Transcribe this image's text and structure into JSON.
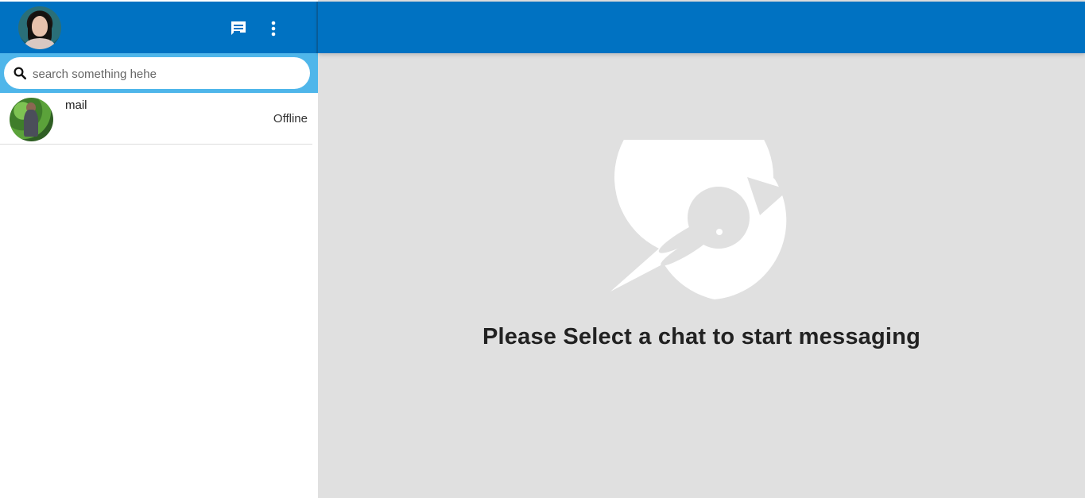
{
  "header": {
    "profile_avatar_alt": "profile-avatar",
    "chat_icon": "chat-icon",
    "menu_icon": "more-vert-icon"
  },
  "search": {
    "placeholder": "search something hehe"
  },
  "chats": [
    {
      "name": "mail",
      "status": "Offline"
    }
  ],
  "main": {
    "empty_message": "Please Select a chat to start messaging",
    "illustration_icon": "chat-bubble-illustration"
  },
  "colors": {
    "header_blue": "#0072c2",
    "search_bar_blue": "#4fb6ea",
    "main_background": "#e0e0e0",
    "text_dark": "#222222"
  }
}
